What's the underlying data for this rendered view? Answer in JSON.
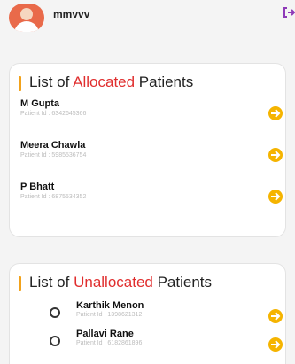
{
  "header": {
    "username": "mmvvv"
  },
  "allocated": {
    "title_prefix": "List of ",
    "title_accent": "Allocated",
    "title_suffix": " Patients",
    "patients": [
      {
        "name": "M Gupta",
        "id_label": "Patient Id : 6342645366"
      },
      {
        "name": "Meera Chawla",
        "id_label": "Patient Id : 5985536754"
      },
      {
        "name": "P Bhatt",
        "id_label": "Patient Id : 6875534352"
      }
    ]
  },
  "unallocated": {
    "title_prefix": "List of ",
    "title_accent": "Unallocated",
    "title_suffix": " Patients",
    "patients": [
      {
        "name": "Karthik Menon",
        "id_label": "Patient Id : 1398621312"
      },
      {
        "name": "Pallavi Rane",
        "id_label": "Patient Id : 6182861896"
      }
    ]
  },
  "colors": {
    "accent_text": "#e02e2e",
    "accent_bar": "#f2a21b",
    "arrow_button": "#f5b400",
    "logout_icon": "#8e3ab8"
  },
  "icons": {
    "row_action": "arrow-right-circle-icon",
    "logout": "logout-icon",
    "avatar": "user-avatar"
  }
}
